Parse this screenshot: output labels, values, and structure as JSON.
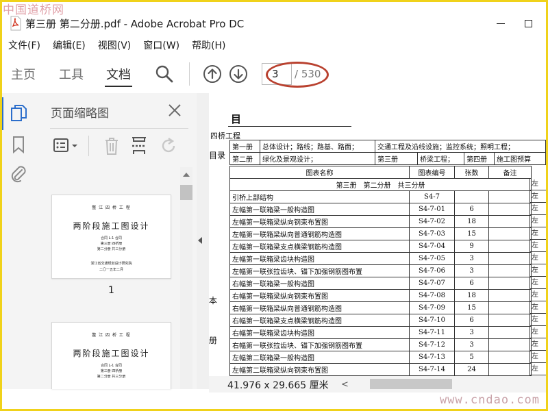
{
  "watermarks": {
    "top_left": "中国道桥网",
    "bottom_right": "www.cndao.com"
  },
  "window": {
    "title": "第三册 第二分册.pdf - Adobe Acrobat Pro DC"
  },
  "menu": [
    "文件(F)",
    "编辑(E)",
    "视图(V)",
    "窗口(W)",
    "帮助(H)"
  ],
  "toolbar": {
    "tabs": [
      "主页",
      "工具",
      "文档"
    ],
    "active_tab": "文档",
    "page_current": "3",
    "page_total": "/ 530",
    "icons": [
      "search-icon",
      "page-up-icon",
      "page-down-icon"
    ]
  },
  "left_strip_icons": [
    "page-thumbnails-icon",
    "bookmark-icon",
    "attachment-icon"
  ],
  "thumb_panel": {
    "title": "页面缩略图",
    "tools": [
      "thumbnail-options-icon",
      "delete-page-icon",
      "insert-page-icon",
      "rotate-page-icon"
    ],
    "thumbnails": [
      {
        "number": "1",
        "header": "鳖 江 四 桥 工 程",
        "title": "两阶段施工图设计",
        "lines": [
          "合同 L-1 合同",
          "第三册  四桥册",
          "第二分册  共三分册"
        ],
        "org": "浙江省交通规划设计研究院",
        "date": "二〇一五年二月"
      },
      {
        "number": "2",
        "header": "鳖 江 四 桥 工 程",
        "title": "两阶段施工图设计",
        "lines": [
          "合同 L-1 合同",
          "第三册  四桥册",
          "第二分册  共三分册"
        ],
        "org": "",
        "date": ""
      }
    ]
  },
  "document": {
    "heading": "目",
    "caption": "四桥工程",
    "left_labels": [
      "目录",
      "本",
      "册"
    ],
    "summary_rows": [
      [
        "第一册",
        "总体设计；路线；路基、路面；",
        "交通工程及沿线设施；监控系统；照明工程；"
      ],
      [
        "第二册",
        "绿化及景观设计；",
        "第三册",
        "桥梁工程；",
        "第四册",
        "施工图预算"
      ]
    ],
    "table_header": [
      "图表名称",
      "图表编号",
      "张数",
      "备注"
    ],
    "section_row": "第三册　第二分册　共三分册",
    "first_row": [
      "引桥上部结构",
      "S4-7",
      "",
      ""
    ],
    "rows": [
      [
        "左幅第一联箱梁一般构造图",
        "S4-7-01",
        "6"
      ],
      [
        "左幅第一联箱梁纵向钢束布置图",
        "S4-7-02",
        "18"
      ],
      [
        "左幅第一联箱梁纵向普通钢筋构造图",
        "S4-7-03",
        "15"
      ],
      [
        "左幅第一联箱梁支点横梁钢筋构造图",
        "S4-7-04",
        "9"
      ],
      [
        "左幅第一联箱梁齿块构造图",
        "S4-7-05",
        "3"
      ],
      [
        "左幅第一联张拉齿块、锚下加强钢筋图布置",
        "S4-7-06",
        "3"
      ],
      [
        "右幅第一联箱梁一般构造图",
        "S4-7-07",
        "6"
      ],
      [
        "右幅第一联箱梁纵向钢束布置图",
        "S4-7-08",
        "18"
      ],
      [
        "右幅第一联箱梁纵向普通钢筋构造图",
        "S4-7-09",
        "15"
      ],
      [
        "右幅第一联箱梁支点横梁钢筋构造图",
        "S4-7-10",
        "6"
      ],
      [
        "右幅第一联箱梁齿块构造图",
        "S4-7-11",
        "3"
      ],
      [
        "右幅第一联张拉齿块、锚下加强钢筋图布置",
        "S4-7-12",
        "3"
      ],
      [
        "左幅第二联箱梁一般构造图",
        "S4-7-13",
        "5"
      ],
      [
        "左幅第二联箱梁纵向钢束布置图",
        "S4-7-14",
        "24"
      ]
    ],
    "right_edge": "左"
  },
  "status": {
    "dimensions": "41.976 x 29.665 厘米"
  },
  "colors": {
    "accent_blue": "#2c6ecb",
    "annotation_red": "#b9412f",
    "frame_yellow": "#f0d21a"
  }
}
